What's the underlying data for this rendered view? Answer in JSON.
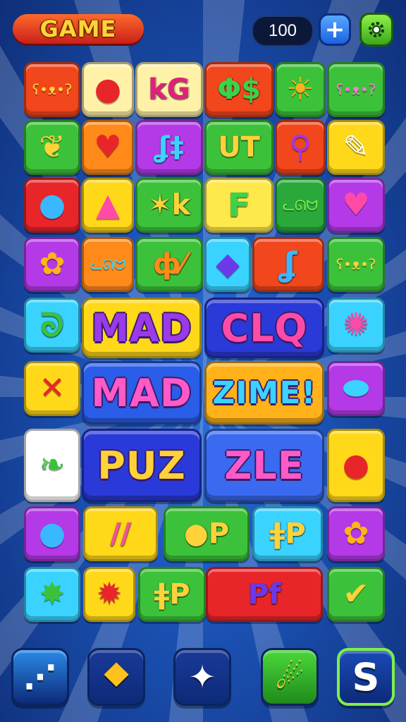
{
  "header": {
    "logo_text": "GAME",
    "coins": "100",
    "add_label": "+"
  },
  "rows": [
    [
      {
        "bg": "#f2461c",
        "fg": "#ffd23a",
        "icon": "face-icon",
        "glyph": "ʕ•ᴥ•ʔ",
        "type": "icon"
      },
      {
        "bg": "#fff2a8",
        "fg": "#e8262a",
        "icon": "balloon-icon",
        "glyph": "●",
        "type": "icon"
      },
      {
        "bg": "#fff2a8",
        "fg": "#e0207a",
        "text": "kG",
        "type": "text"
      },
      {
        "bg": "#f2461c",
        "fg": "#3ad34a",
        "text": "Φ$",
        "type": "text"
      },
      {
        "bg": "#3cc23a",
        "fg": "#ffb21a",
        "icon": "sun-icon",
        "glyph": "☀",
        "type": "icon"
      },
      {
        "bg": "#3cc23a",
        "fg": "#ff7ad4",
        "icon": "face-icon",
        "glyph": "ʕ•ᴥ•ʔ",
        "type": "icon"
      }
    ],
    [
      {
        "bg": "#3cc23a",
        "fg": "#ffd23a",
        "icon": "leaf-icon",
        "glyph": "❦",
        "type": "icon"
      },
      {
        "bg": "#ff8a1a",
        "fg": "#e8262a",
        "icon": "heart-icon",
        "glyph": "♥",
        "type": "icon"
      },
      {
        "bg": "#b43ae8",
        "fg": "#3ad3ff",
        "text": "ʆ‡",
        "type": "text"
      },
      {
        "bg": "#3cc23a",
        "fg": "#ffd23a",
        "text": "UT",
        "type": "text"
      },
      {
        "bg": "#f2461c",
        "fg": "#9a3ae8",
        "icon": "magnifier-icon",
        "glyph": "⚲",
        "type": "icon"
      },
      {
        "bg": "#ffd81a",
        "fg": "#ffffff",
        "icon": "pencil-icon",
        "glyph": "✎",
        "type": "icon"
      }
    ],
    [
      {
        "bg": "#e8262a",
        "fg": "#3ab8ff",
        "icon": "balloon-icon",
        "glyph": "●",
        "type": "icon"
      },
      {
        "bg": "#ffd81a",
        "fg": "#ff4aa8",
        "icon": "triangle-icon",
        "glyph": "▲",
        "type": "icon"
      },
      {
        "bg": "#3cc23a",
        "fg": "#ffd23a",
        "text": "✶k",
        "type": "text"
      },
      {
        "bg": "#ffe84a",
        "fg": "#3ad34a",
        "text": "F",
        "type": "text"
      },
      {
        "bg": "#2aa83a",
        "fg": "#7cf04a",
        "icon": "cat-icon",
        "glyph": "ᓚᘏᗢ",
        "type": "icon"
      },
      {
        "bg": "#b43ae8",
        "fg": "#ff4aa8",
        "icon": "heart-frame-icon",
        "glyph": "♥",
        "type": "icon"
      }
    ],
    [
      {
        "bg": "#b43ae8",
        "fg": "#ffb21a",
        "icon": "flower-icon",
        "glyph": "✿",
        "type": "icon"
      },
      {
        "bg": "#ff8a1a",
        "fg": "#3ad3ff",
        "icon": "cat-icon",
        "glyph": "ᓚᘏᗢ",
        "type": "icon"
      },
      {
        "bg": "#3cc23a",
        "fg": "#ff8a1a",
        "text": "ф⁄",
        "type": "text"
      },
      {
        "bg": "#3ad3ff",
        "fg": "#6a3ae8",
        "icon": "diamond-icon",
        "glyph": "◆",
        "type": "icon"
      },
      {
        "bg": "#f2461c",
        "fg": "#3ab8ff",
        "text": "ʆ",
        "type": "text"
      },
      {
        "bg": "#3cc23a",
        "fg": "#ffd23a",
        "icon": "bear-icon",
        "glyph": "ʕ•ᴥ•ʔ",
        "type": "icon"
      }
    ],
    [
      {
        "bg": "#3ad3ff",
        "fg": "#3cc23a",
        "text": "ᘐ",
        "type": "text"
      },
      {
        "bg": "#3ad3ff",
        "fg": "#ff4aa8",
        "icon": "sun-icon",
        "glyph": "✺",
        "type": "icon"
      }
    ],
    [
      {
        "bg": "#ffd81a",
        "fg": "#e8262a",
        "icon": "cross-icon",
        "glyph": "✕",
        "type": "icon"
      },
      {
        "bg": "#b43ae8",
        "fg": "#3ad3ff",
        "icon": "wrench-icon",
        "glyph": "⬬",
        "type": "icon"
      }
    ],
    [
      {
        "bg": "#ffffff",
        "fg": "#3cc23a",
        "icon": "leaf-icon",
        "glyph": "❧",
        "type": "icon"
      },
      {
        "bg": "#ffd81a",
        "fg": "#e8262a",
        "icon": "balloon-icon",
        "glyph": "●",
        "type": "icon"
      }
    ],
    [
      {
        "bg": "#b43ae8",
        "fg": "#3ab8ff",
        "icon": "balloon-icon",
        "glyph": "●",
        "type": "icon"
      },
      {
        "bg": "#ffd81a",
        "fg": "#ff4aa8",
        "text": "∕∕",
        "type": "text"
      },
      {
        "bg": "#3cc23a",
        "fg": "#ffd23a",
        "text": "●P",
        "type": "text"
      },
      {
        "bg": "#3ad3ff",
        "fg": "#ffd23a",
        "text": "ǂP",
        "type": "text"
      },
      {
        "bg": "#b43ae8",
        "fg": "#ffb21a",
        "icon": "flower-icon",
        "glyph": "✿",
        "type": "icon"
      }
    ],
    [
      {
        "bg": "#3ad3ff",
        "fg": "#3cc23a",
        "icon": "star-icon",
        "glyph": "✸",
        "type": "icon"
      },
      {
        "bg": "#ffd81a",
        "fg": "#e8262a",
        "icon": "monster-icon",
        "glyph": "✹",
        "type": "icon"
      },
      {
        "bg": "#3cc23a",
        "fg": "#ffd23a",
        "text": "ǂP",
        "type": "text"
      },
      {
        "bg": "#e8262a",
        "fg": "#6a3ae8",
        "text": "Pf",
        "type": "text"
      },
      {
        "bg": "#3cc23a",
        "fg": "#ffd23a",
        "icon": "check-icon",
        "glyph": "✔",
        "type": "icon"
      }
    ]
  ],
  "words": [
    {
      "text": "MAD",
      "bg": "#ffd81a",
      "fg": "#9a3ae8"
    },
    {
      "text": "CLQ",
      "bg": "#2a3ad8",
      "fg": "#ff4aa8"
    },
    {
      "text": "MAD",
      "bg": "#2a5ee8",
      "fg": "#ff5ac8"
    },
    {
      "text": "ZIME!",
      "bg": "#ffb21a",
      "fg": "#3ad3ff"
    },
    {
      "text": "PUZ",
      "bg": "#2a3ad8",
      "fg": "#ffd23a"
    },
    {
      "text": "ZLE",
      "bg": "#3a6af0",
      "fg": "#ff5ac8"
    }
  ],
  "bottom": [
    {
      "name": "share-button",
      "icon": "share-icon",
      "bg": "#2a8ae8",
      "glyph": "⋰"
    },
    {
      "name": "hint-button",
      "icon": "kite-icon",
      "bg": "#1a3a98",
      "glyph": "⯁"
    },
    {
      "name": "shuffle-button",
      "icon": "shuriken-icon",
      "bg": "#1a3a98",
      "glyph": "✦"
    },
    {
      "name": "boost-button",
      "icon": "rocket-icon",
      "bg": "#2ab83a",
      "glyph": "☄"
    },
    {
      "name": "score-button",
      "icon": "s-icon",
      "bg": "#1a4ab8",
      "glyph": "S"
    }
  ]
}
